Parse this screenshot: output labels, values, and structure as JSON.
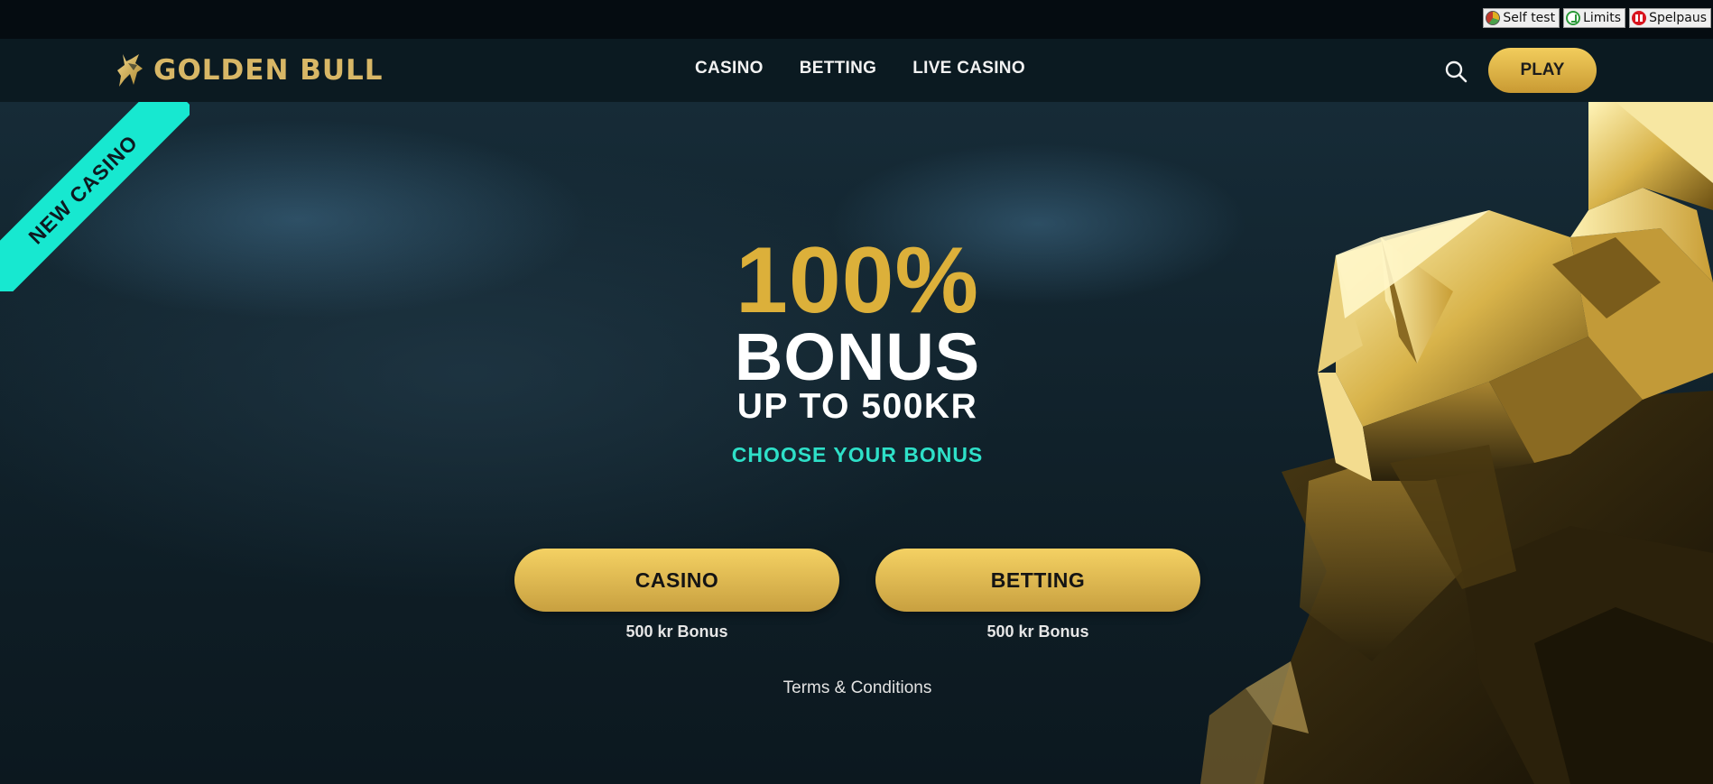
{
  "rg_bar": {
    "items": [
      {
        "label": "Self test",
        "icon": "self-test-icon"
      },
      {
        "label": "Limits",
        "icon": "limits-icon"
      },
      {
        "label": "Spelpaus",
        "icon": "spelpaus-pause-icon"
      }
    ]
  },
  "header": {
    "logo_text": "GOLDEN BULL",
    "nav": [
      "CASINO",
      "BETTING",
      "LIVE CASINO"
    ],
    "search_icon": "search-icon",
    "play_label": "PLAY"
  },
  "hero": {
    "ribbon": "NEW CASINO",
    "headline_pct": "100%",
    "headline_bonus": "BONUS",
    "headline_upto": "UP TO 500KR",
    "choose": "CHOOSE YOUR BONUS",
    "offers": [
      {
        "label": "CASINO",
        "sub": "500 kr Bonus"
      },
      {
        "label": "BETTING",
        "sub": "500 kr Bonus"
      }
    ],
    "terms": "Terms & Conditions"
  },
  "colors": {
    "gold": "#dcb03a",
    "teal": "#17e8d0",
    "background": "#112028",
    "nav_bg": "#0b1a21"
  }
}
